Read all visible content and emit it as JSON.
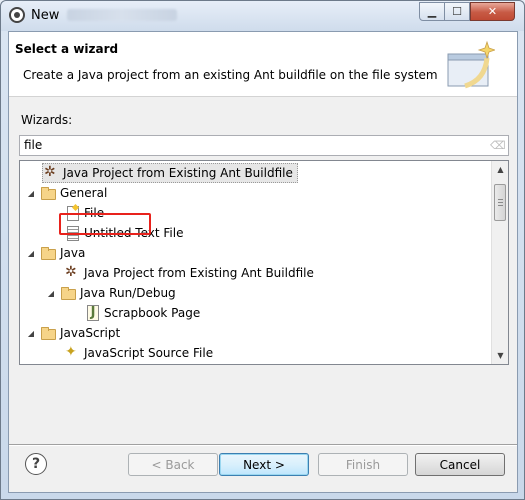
{
  "window": {
    "title": "New"
  },
  "header": {
    "title": "Select a wizard",
    "description": "Create a Java project from an existing Ant buildfile on the file system"
  },
  "wizards": {
    "label": "Wizards:",
    "filter_value": "file"
  },
  "tree": {
    "items": [
      {
        "label": "Java Project from Existing Ant Buildfile",
        "icon": "ant-icon",
        "selected": true
      },
      {
        "label": "General",
        "icon": "folder-icon",
        "expanded": true
      },
      {
        "label": "File",
        "icon": "file-icon",
        "highlighted": true
      },
      {
        "label": "Untitled Text File",
        "icon": "text-file-icon"
      },
      {
        "label": "Java",
        "icon": "folder-icon",
        "expanded": true
      },
      {
        "label": "Java Project from Existing Ant Buildfile",
        "icon": "ant-icon"
      },
      {
        "label": "Java Run/Debug",
        "icon": "folder-icon",
        "expanded": true
      },
      {
        "label": "Scrapbook Page",
        "icon": "scrapbook-icon"
      },
      {
        "label": "JavaScript",
        "icon": "folder-icon",
        "expanded": true
      },
      {
        "label": "JavaScript Source File",
        "icon": "javascript-icon"
      }
    ]
  },
  "buttons": {
    "help": "?",
    "back": "< Back",
    "next": "Next >",
    "finish": "Finish",
    "cancel": "Cancel"
  },
  "colors": {
    "highlight_box": "#e8221c",
    "default_button_border": "#3c7fb1"
  }
}
